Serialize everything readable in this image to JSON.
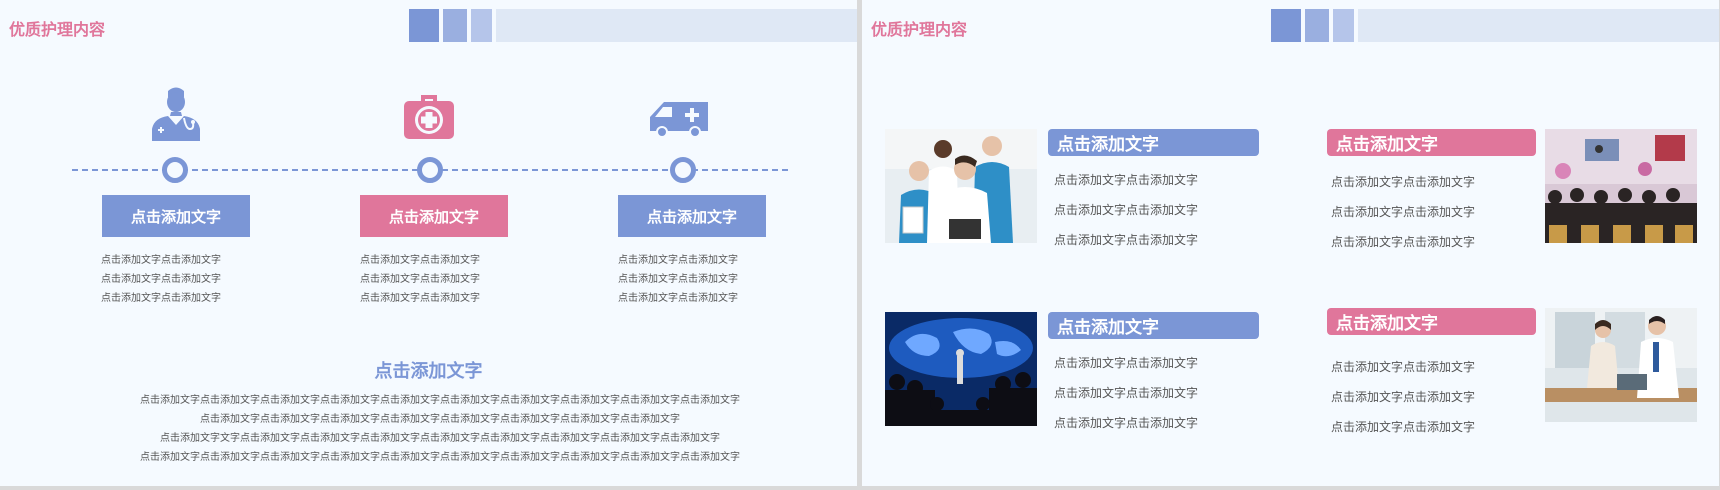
{
  "colors": {
    "blue": "#7b96d6",
    "pink": "#e0769b",
    "background": "#f5faff",
    "deco_light": "#dfe8f5"
  },
  "slide_left": {
    "title": "优质护理内容",
    "steps": [
      {
        "icon": "nurse-icon",
        "color": "blue",
        "heading": "点击添加文字",
        "lines": [
          "点击添加文字点击添加文字",
          "点击添加文字点击添加文字",
          "点击添加文字点击添加文字"
        ]
      },
      {
        "icon": "first-aid-kit-icon",
        "color": "pink",
        "heading": "点击添加文字",
        "lines": [
          "点击添加文字点击添加文字",
          "点击添加文字点击添加文字",
          "点击添加文字点击添加文字"
        ]
      },
      {
        "icon": "ambulance-icon",
        "color": "blue",
        "heading": "点击添加文字",
        "lines": [
          "点击添加文字点击添加文字",
          "点击添加文字点击添加文字",
          "点击添加文字点击添加文字"
        ]
      }
    ],
    "bottom_heading": "点击添加文字",
    "bottom_lines": [
      "点击添加文字点击添加文字点击添加文字点击添加文字点击添加文字点击添加文字点击添加文字点击添加文字点击添加文字点击添加文字",
      "点击添加文字点击添加文字点击添加文字点击添加文字点击添加文字点击添加文字点击添加文字点击添加文字",
      "点击添加文字文字点击添加文字点击添加文字点击添加文字点击添加文字点击添加文字点击添加文字点击添加文字点击添加文字",
      "点击添加文字点击添加文字点击添加文字点击添加文字点击添加文字点击添加文字点击添加文字点击添加文字点击添加文字点击添加文字"
    ]
  },
  "slide_right": {
    "title": "优质护理内容",
    "cards": [
      {
        "photo": "medical-team-photo",
        "color": "blue",
        "label": "点击添加文字",
        "lines": [
          "点击添加文字点击添加文字",
          "点击添加文字点击添加文字",
          "点击添加文字点击添加文字"
        ]
      },
      {
        "photo": "conference-audience-photo",
        "color": "pink",
        "label": "点击添加文字",
        "lines": [
          "点击添加文字点击添加文字",
          "点击添加文字点击添加文字",
          "点击添加文字点击添加文字"
        ]
      },
      {
        "photo": "world-map-presentation-photo",
        "color": "blue",
        "label": "点击添加文字",
        "lines": [
          "点击添加文字点击添加文字",
          "点击添加文字点击添加文字",
          "点击添加文字点击添加文字"
        ]
      },
      {
        "photo": "business-meeting-photo",
        "color": "pink",
        "label": "点击添加文字",
        "lines": [
          "点击添加文字点击添加文字",
          "点击添加文字点击添加文字",
          "点击添加文字点击添加文字"
        ]
      }
    ]
  }
}
